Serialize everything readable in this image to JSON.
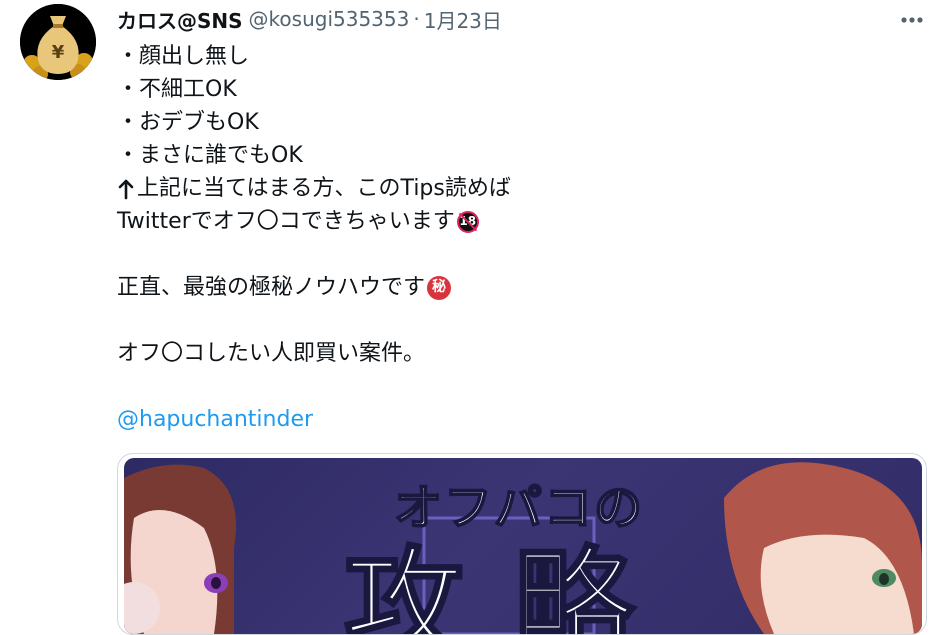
{
  "tweet": {
    "display_name": "カロス@SNS",
    "handle": "@kosugi535353",
    "separator": "·",
    "date": "1月23日",
    "more_icon": "ellipsis-icon",
    "avatar_icon": "money-bag-yen-icon",
    "lines": [
      "・顔出し無し",
      "・不細工OK",
      "・おデブもOK",
      "・まさに誰でもOK",
      "上記に当てはまる方、このTips読めば",
      "Twitterでオフ〇コできちゃいます",
      "正直、最強の極秘ノウハウです",
      "オフ〇コしたい人即買い案件。"
    ],
    "arrow_icon": "up-arrow-icon",
    "emoji_18": "18",
    "emoji_secret": "秘",
    "mention": "@hapuchantinder"
  },
  "media": {
    "title_text": "オフパコの",
    "big_text": "攻略",
    "image_icon": "manga-illustration"
  },
  "colors": {
    "link": "#1d9bf0",
    "secondary_text": "#536471",
    "media_bg": "#332e6b"
  }
}
